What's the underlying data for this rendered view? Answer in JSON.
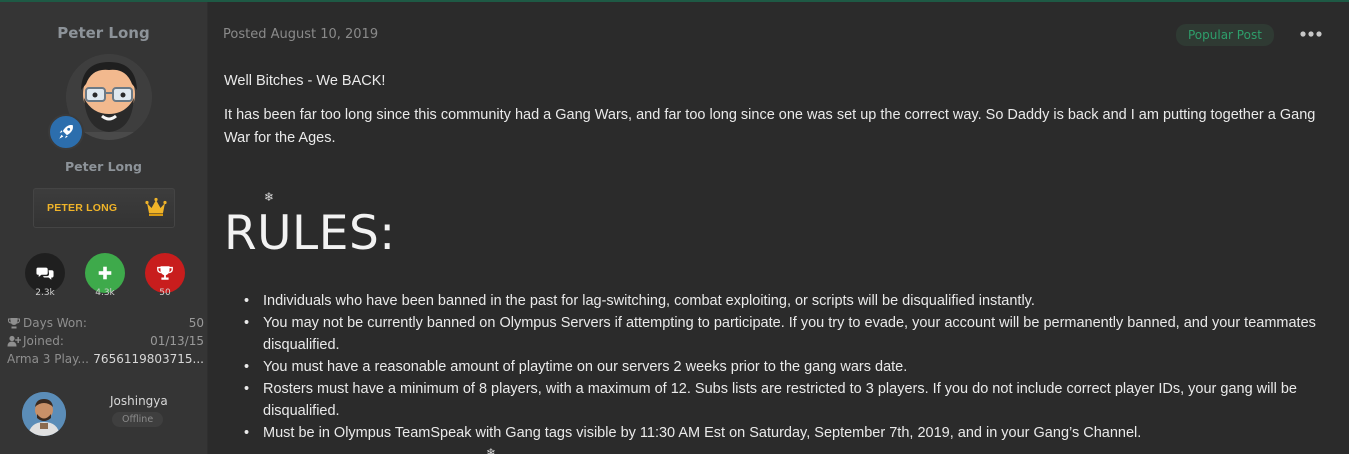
{
  "author": {
    "name": "Peter Long",
    "display_name": "Peter Long",
    "group_label": "PETER LONG",
    "stats": [
      {
        "name": "posts",
        "count": "2.3k",
        "color": "#222222"
      },
      {
        "name": "reputation",
        "count": "4.3k",
        "color": "#3eaa4b"
      },
      {
        "name": "achievements",
        "count": "50",
        "color": "#c81d1d"
      }
    ],
    "info": {
      "days_won_label": "Days Won:",
      "days_won_value": "50",
      "joined_label": "Joined:",
      "joined_value": "01/13/15",
      "arma_label": "Arma 3 Play...",
      "arma_value": "7656119803715..."
    }
  },
  "viewer": {
    "name": "Joshingya",
    "status": "Offline"
  },
  "post": {
    "meta": "Posted August 10, 2019",
    "badge": "Popular Post",
    "greeting": "Well Bitches - We BACK!",
    "intro": "It has been far too long since this community had a Gang Wars, and far too long since one was set up the correct way. So Daddy is back and I am putting together a Gang War for the Ages.",
    "rules_heading": "RULES:",
    "rules": [
      "Individuals who have been banned in the past for lag-switching, combat exploiting, or scripts will be disqualified instantly.",
      "You may not be currently banned on Olympus Servers if attempting to participate. If you try to evade, your account will be permanently banned, and your teammates disqualified.",
      "You must have a reasonable amount of playtime on our servers 2 weeks prior to the gang wars date.",
      "Rosters must have a minimum of 8 players, with a maximum of 12. Subs lists are restricted to 3 players. If you do not include correct player IDs, your gang will be disqualified.",
      "Must be in Olympus TeamSpeak with Gang tags visible by 11:30 AM Est on Saturday, September 7th, 2019, and in your Gang’s Channel."
    ]
  },
  "colors": {
    "background": "#2b2b2b",
    "sidebar": "#353535",
    "accent_green": "#2e9e6b",
    "group_gold": "#f0b429",
    "rank_blue": "#2c6ead"
  }
}
